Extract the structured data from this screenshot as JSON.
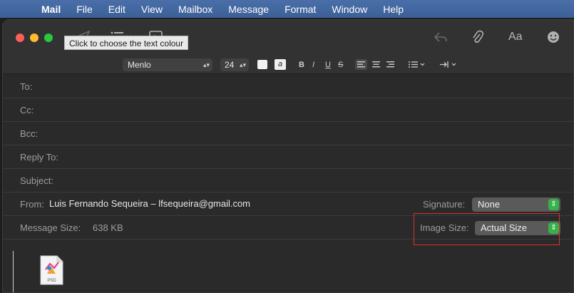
{
  "menubar": {
    "app": "Mail",
    "items": [
      "File",
      "Edit",
      "View",
      "Mailbox",
      "Message",
      "Format",
      "Window",
      "Help"
    ]
  },
  "tooltip": "Click to choose the text colour",
  "toolbar_format": {
    "font": "Menlo",
    "size": "24"
  },
  "fields": {
    "to": "To:",
    "cc": "Cc:",
    "bcc": "Bcc:",
    "reply_to": "Reply To:",
    "subject": "Subject:",
    "from_label": "From:",
    "from_value": "Luis Fernando Sequeira – lfsequeira@gmail.com",
    "signature_label": "Signature:",
    "signature_value": "None",
    "message_size_label": "Message Size:",
    "message_size_value": "638 KB",
    "image_size_label": "Image Size:",
    "image_size_value": "Actual Size"
  },
  "attachment": {
    "type_label": "PSD"
  },
  "colors": {
    "menubar": "#3c5f97",
    "close": "#fe5f57",
    "minimize": "#febc2e",
    "zoom": "#28c840",
    "highlight_box": "#d6342c",
    "stepper": "#35b24a"
  }
}
